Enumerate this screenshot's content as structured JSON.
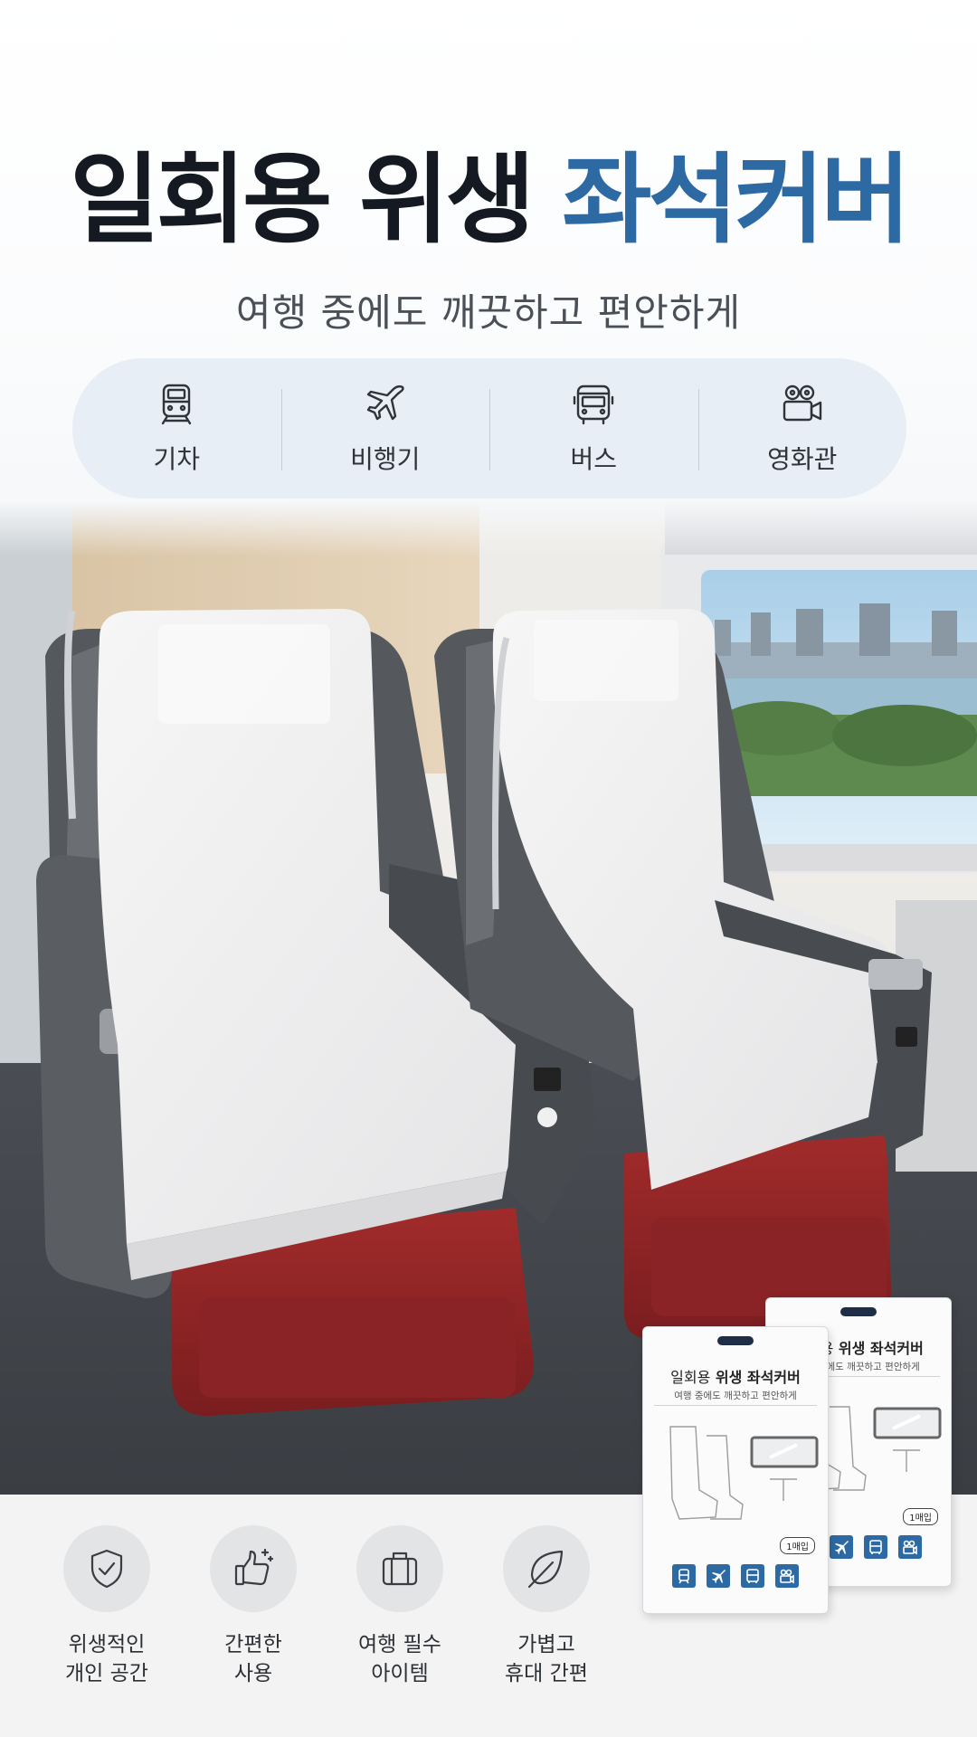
{
  "header": {
    "title_main": "일회용 위생",
    "title_accent": "좌석커버",
    "subtitle": "여행 중에도 깨끗하고 편안하게"
  },
  "usage": [
    {
      "label": "기차",
      "icon": "train-icon"
    },
    {
      "label": "비행기",
      "icon": "airplane-icon"
    },
    {
      "label": "버스",
      "icon": "bus-icon"
    },
    {
      "label": "영화관",
      "icon": "movie-camera-icon"
    }
  ],
  "features": [
    {
      "line1": "위생적인",
      "line2": "개인 공간",
      "icon": "shield-check-icon"
    },
    {
      "line1": "간편한",
      "line2": "사용",
      "icon": "thumbs-up-sparkle-icon"
    },
    {
      "line1": "여행 필수",
      "line2": "아이템",
      "icon": "suitcase-icon"
    },
    {
      "line1": "가볍고",
      "line2": "휴대 간편",
      "icon": "leaf-icon"
    }
  ],
  "package": {
    "title_light": "일회용",
    "title_bold": "위생 좌석커버",
    "subtitle": "여행 중에도 깨끗하고 편안하게",
    "count": "1매입",
    "icons": [
      "train-icon",
      "airplane-icon",
      "bus-icon",
      "movie-camera-icon"
    ]
  },
  "colors": {
    "accent": "#2d6aa3",
    "title_dark": "#151a22",
    "usage_bar_bg": "#e8eef5",
    "seat_red": "#8e2424",
    "seat_gray": "#4f5358"
  }
}
